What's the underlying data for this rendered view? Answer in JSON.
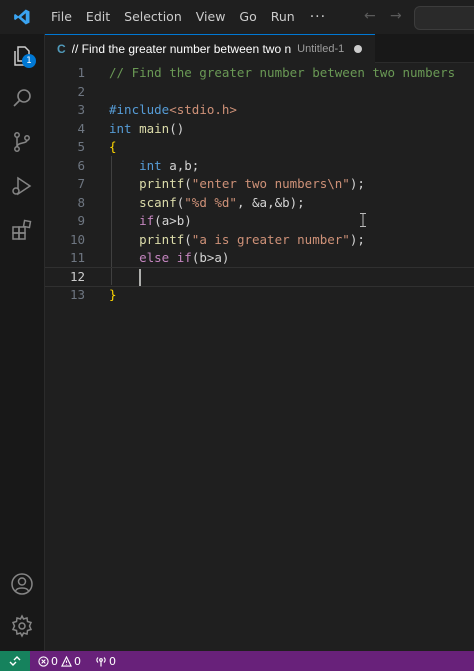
{
  "menu": {
    "items": [
      "File",
      "Edit",
      "Selection",
      "View",
      "Go",
      "Run"
    ],
    "more": "···"
  },
  "activity": {
    "explorer_badge": "1"
  },
  "tab": {
    "lang": "C",
    "title": "// Find the greater number between two n",
    "description": "Untitled-1"
  },
  "editor": {
    "lines": [
      {
        "n": "1",
        "tokens": [
          [
            "comment",
            "// Find the greater number between two numbers"
          ]
        ]
      },
      {
        "n": "2",
        "tokens": []
      },
      {
        "n": "3",
        "tokens": [
          [
            "keyword",
            "#include"
          ],
          [
            "string",
            "<stdio.h>"
          ]
        ]
      },
      {
        "n": "4",
        "tokens": [
          [
            "keyword",
            "int"
          ],
          [
            "text",
            " "
          ],
          [
            "func",
            "main"
          ],
          [
            "text",
            "()"
          ]
        ]
      },
      {
        "n": "5",
        "tokens": [
          [
            "brace",
            "{"
          ]
        ]
      },
      {
        "n": "6",
        "tokens": [
          [
            "text",
            "    "
          ],
          [
            "keyword",
            "int"
          ],
          [
            "text",
            " a,b;"
          ]
        ]
      },
      {
        "n": "7",
        "tokens": [
          [
            "text",
            "    "
          ],
          [
            "func",
            "printf"
          ],
          [
            "text",
            "("
          ],
          [
            "string",
            "\"enter two numbers\\n\""
          ],
          [
            "text",
            ");"
          ]
        ]
      },
      {
        "n": "8",
        "tokens": [
          [
            "text",
            "    "
          ],
          [
            "func",
            "scanf"
          ],
          [
            "text",
            "("
          ],
          [
            "string",
            "\"%d %d\""
          ],
          [
            "text",
            ", &a,&b);"
          ]
        ]
      },
      {
        "n": "9",
        "tokens": [
          [
            "text",
            "    "
          ],
          [
            "control",
            "if"
          ],
          [
            "text",
            "(a>b)"
          ]
        ]
      },
      {
        "n": "10",
        "tokens": [
          [
            "text",
            "    "
          ],
          [
            "func",
            "printf"
          ],
          [
            "text",
            "("
          ],
          [
            "string",
            "\"a is greater number\""
          ],
          [
            "text",
            ");"
          ]
        ]
      },
      {
        "n": "11",
        "tokens": [
          [
            "text",
            "    "
          ],
          [
            "control",
            "else"
          ],
          [
            "text",
            " "
          ],
          [
            "control",
            "if"
          ],
          [
            "text",
            "(b>a)"
          ]
        ]
      },
      {
        "n": "12",
        "tokens": []
      },
      {
        "n": "13",
        "tokens": [
          [
            "brace",
            "}"
          ]
        ]
      }
    ],
    "current_line": "12"
  },
  "status": {
    "errors": "0",
    "warnings": "0",
    "ports": "0"
  },
  "colors": {
    "accent": "#0078d4",
    "statusbar": "#68217a",
    "remote": "#16825d"
  }
}
